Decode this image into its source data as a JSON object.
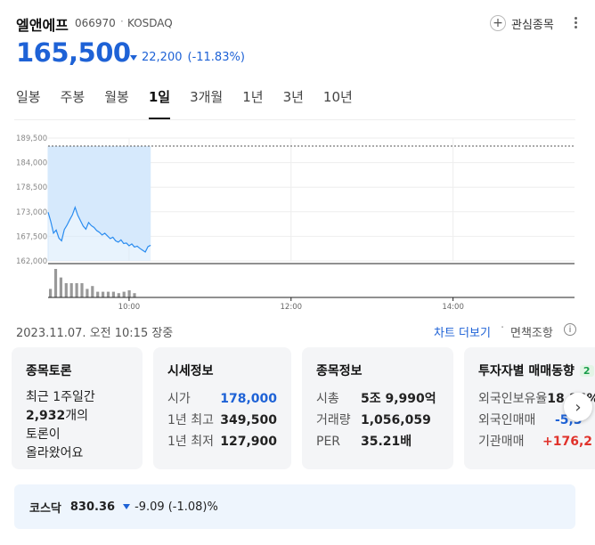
{
  "stock": {
    "name": "엘앤에프",
    "code": "066970",
    "separator": "·",
    "market": "KOSDAQ",
    "price": "165,500",
    "change": "22,200",
    "change_pct": "(-11.83%)",
    "direction": "down"
  },
  "header": {
    "watch_label": "관심종목"
  },
  "tabs": [
    {
      "label": "일봉",
      "active": false
    },
    {
      "label": "주봉",
      "active": false
    },
    {
      "label": "월봉",
      "active": false
    },
    {
      "label": "1일",
      "active": true
    },
    {
      "label": "3개월",
      "active": false
    },
    {
      "label": "1년",
      "active": false
    },
    {
      "label": "3년",
      "active": false
    },
    {
      "label": "10년",
      "active": false
    }
  ],
  "chart_data": {
    "type": "line",
    "y_ticks": [
      "189,500",
      "184,000",
      "178,500",
      "173,000",
      "167,500",
      "162,000"
    ],
    "ylim": [
      162000,
      189500
    ],
    "previous_close": 187700,
    "x_ticks": [
      "10:00",
      "12:00",
      "14:00"
    ],
    "x_tick_minutes": [
      60,
      180,
      300
    ],
    "xlim_minutes": [
      0,
      390
    ],
    "x_minutes": [
      0,
      2,
      4,
      6,
      8,
      10,
      12,
      14,
      16,
      18,
      20,
      22,
      24,
      26,
      28,
      30,
      32,
      34,
      36,
      38,
      40,
      42,
      44,
      46,
      48,
      50,
      52,
      54,
      56,
      58,
      60,
      62,
      64,
      66,
      68,
      70,
      72,
      74,
      76
    ],
    "price": [
      172900,
      170800,
      168200,
      168900,
      167100,
      166500,
      169000,
      170000,
      171200,
      172300,
      174000,
      172200,
      171000,
      169800,
      169100,
      170600,
      169900,
      169500,
      168800,
      168400,
      167800,
      168200,
      167600,
      167000,
      167300,
      166500,
      166200,
      166700,
      165900,
      166000,
      165400,
      165800,
      165100,
      165300,
      164800,
      164400,
      164000,
      165200,
      165500
    ],
    "volume_bars": [
      3,
      10,
      7,
      5,
      5,
      5,
      5,
      3,
      4,
      2,
      2,
      2,
      2,
      1.5,
      2,
      2.5,
      1.5
    ]
  },
  "footer": {
    "timestamp": "2023.11.07. 오전 10:15 장중",
    "more_chart": "차트 더보기",
    "dot": "·",
    "disclaimer": "면책조항",
    "info_icon": "i"
  },
  "cards": {
    "discussion": {
      "title": "종목토론",
      "line1": "최근 1주일간",
      "count": "2,932",
      "count_suffix": "개의",
      "line3": "토론이",
      "line4": "올라왔어요"
    },
    "quote": {
      "title": "시세정보",
      "rows": [
        {
          "label": "시가",
          "value": "178,000"
        },
        {
          "label": "1년 최고",
          "value": "349,500"
        },
        {
          "label": "1년 최저",
          "value": "127,900"
        }
      ]
    },
    "info": {
      "title": "종목정보",
      "rows": [
        {
          "label": "시총",
          "value": "5조 9,990억"
        },
        {
          "label": "거래량",
          "value": "1,056,059"
        },
        {
          "label": "PER",
          "value": "35.21배"
        }
      ]
    },
    "investor": {
      "title": "투자자별 매매동향",
      "badge": "2",
      "rows": [
        {
          "label": "외국인보유율",
          "value": "18.24%"
        },
        {
          "label": "외국인매매",
          "value": "-5,3"
        },
        {
          "label": "기관매매",
          "value": "+176,2"
        }
      ]
    }
  },
  "index": {
    "name": "코스닥",
    "value": "830.36",
    "change": "-9.09",
    "change_pct": "(-1.08)%"
  },
  "colors": {
    "accent_blue": "#1e62d6",
    "down_blue": "#1e62d6",
    "up_red": "#e0322b",
    "chart_line": "#2a8cf0",
    "chart_fill": "#d6e9fc"
  }
}
